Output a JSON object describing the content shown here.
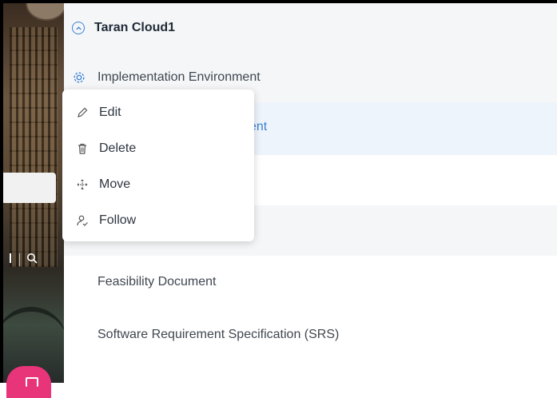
{
  "header": {
    "title": "Taran Cloud1",
    "collapse_icon": "chevron-up-circle-icon"
  },
  "rows": [
    {
      "label": "Implementation Environment",
      "icon": "gear-icon"
    },
    {
      "label": "ent",
      "style": "link"
    },
    {
      "label": ""
    },
    {
      "label": ""
    },
    {
      "label": "Feasibility Document"
    },
    {
      "label": "Software Requirement Specification (SRS)"
    }
  ],
  "context_menu": {
    "items": [
      {
        "label": "Edit",
        "icon": "pencil-icon"
      },
      {
        "label": "Delete",
        "icon": "trash-icon"
      },
      {
        "label": "Move",
        "icon": "move-arrows-icon"
      },
      {
        "label": "Follow",
        "icon": "follow-user-icon"
      }
    ]
  },
  "colors": {
    "accent": "#3b82d6",
    "header_bg": "#f5f6f8",
    "selected_row_bg": "#eef4fb",
    "fab": "#e8357a"
  }
}
